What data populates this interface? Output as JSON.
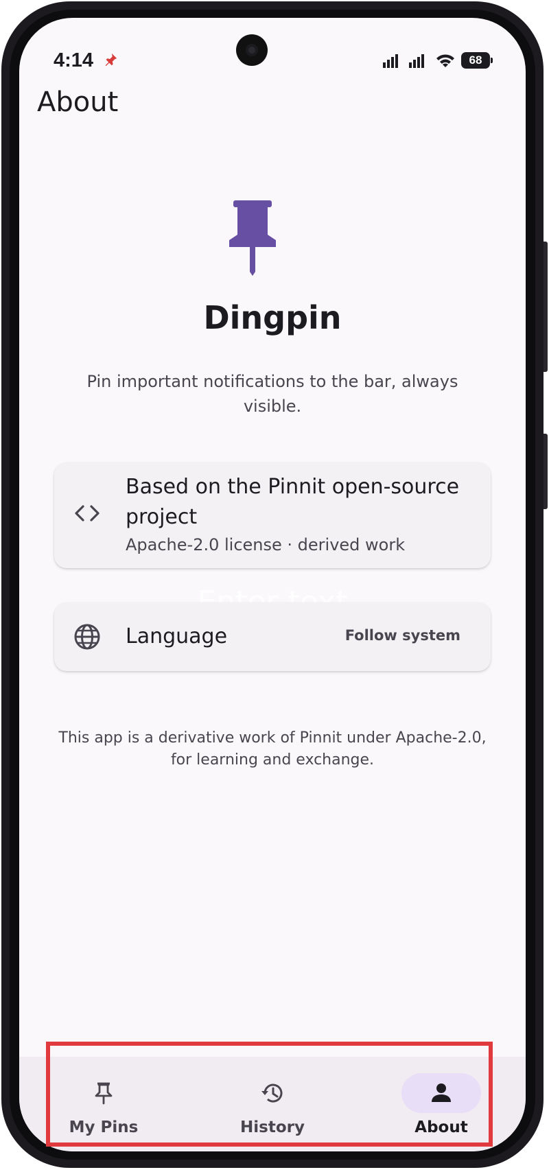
{
  "status_bar": {
    "time": "4:14",
    "battery": "68",
    "notification_icon": "pin-notification-icon"
  },
  "header": {
    "title": "About"
  },
  "app_info": {
    "icon": "pushpin-icon",
    "name": "Dingpin",
    "tagline": "Pin important notifications to the bar, always visible."
  },
  "cards": {
    "source": {
      "icon": "code-icon",
      "title": "Based on the Pinnit open-source project",
      "subtitle": "Apache-2.0 license · derived work"
    },
    "language": {
      "icon": "globe-icon",
      "title": "Language",
      "value": "Follow system"
    }
  },
  "overlay": {
    "watermark": "Enter text"
  },
  "footer": {
    "text": "This app is a derivative work of Pinnit under Apache-2.0, for learning and exchange."
  },
  "bottom_nav": {
    "items": [
      {
        "label": "My Pins",
        "icon": "pushpin-icon",
        "active": false
      },
      {
        "label": "History",
        "icon": "history-icon",
        "active": false
      },
      {
        "label": "About",
        "icon": "person-icon",
        "active": true
      }
    ]
  },
  "colors": {
    "accent": "#6750a4",
    "active_indicator": "#e8def8",
    "highlight": "#e03a3e",
    "background": "#fbf8fc"
  }
}
